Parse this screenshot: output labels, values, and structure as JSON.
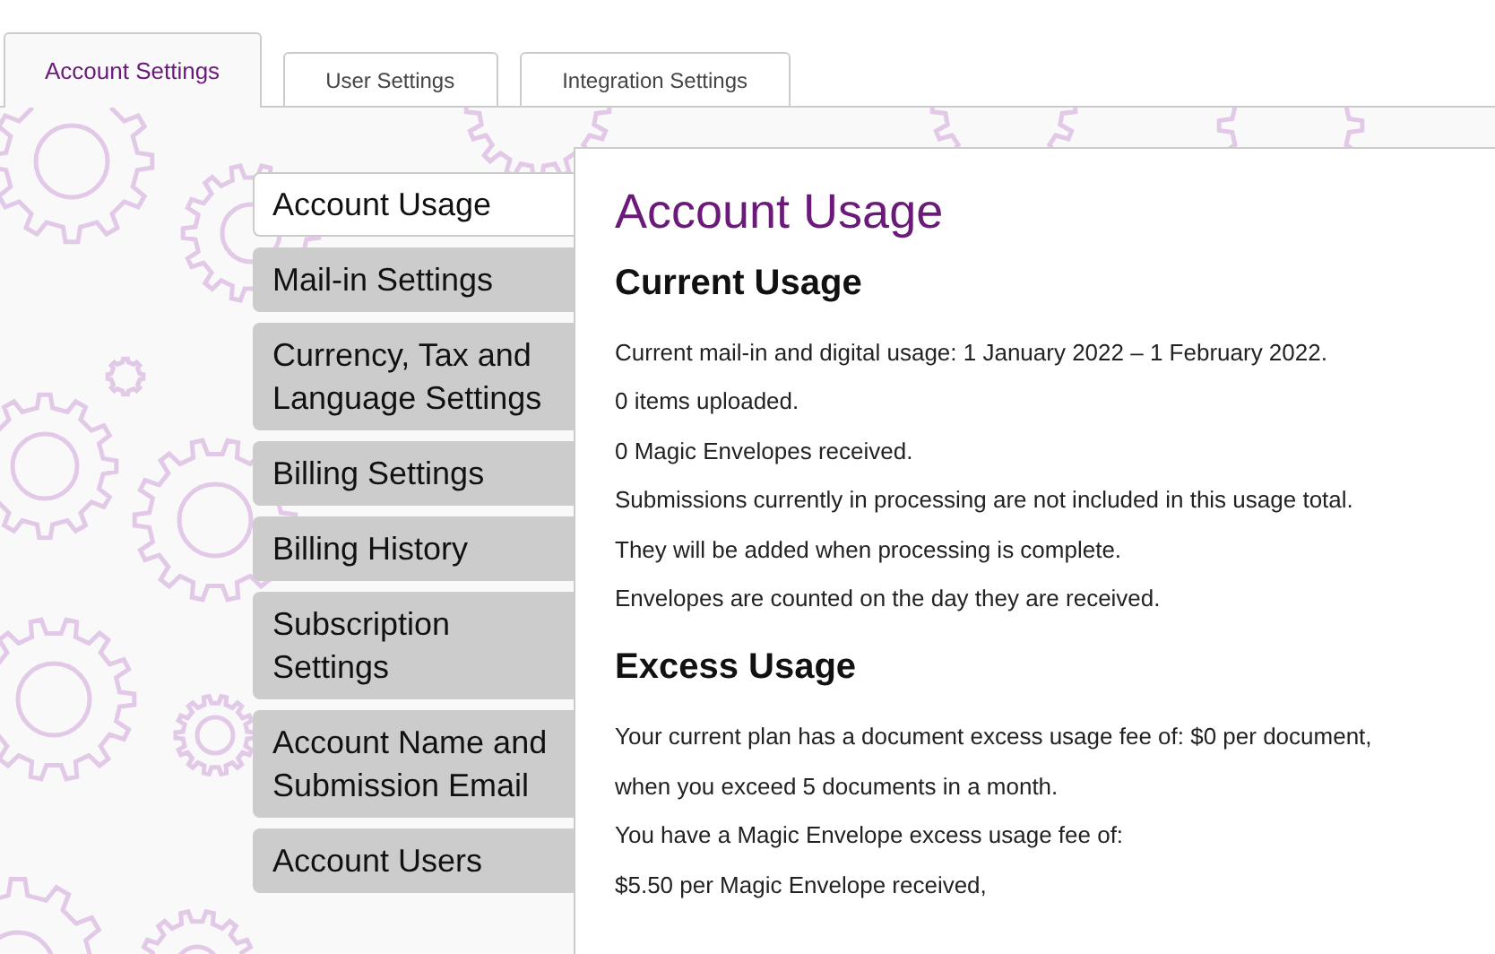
{
  "tabs": [
    {
      "label": "Account Settings",
      "selected": true
    },
    {
      "label": "User Settings",
      "selected": false
    },
    {
      "label": "Integration Settings",
      "selected": false
    }
  ],
  "sidebar": {
    "items": [
      {
        "label": "Account Usage",
        "selected": true
      },
      {
        "label": "Mail-in Settings",
        "selected": false
      },
      {
        "label": "Currency, Tax and Language Settings",
        "selected": false
      },
      {
        "label": "Billing Settings",
        "selected": false
      },
      {
        "label": "Billing History",
        "selected": false
      },
      {
        "label": "Subscription Settings",
        "selected": false
      },
      {
        "label": "Account Name and Submission Email",
        "selected": false
      },
      {
        "label": "Account Users",
        "selected": false
      }
    ]
  },
  "content": {
    "title": "Account Usage",
    "sections": [
      {
        "heading": "Current Usage",
        "lines": [
          "Current mail-in and digital usage: 1 January 2022 – 1 February 2022.",
          "0 items uploaded.",
          "0 Magic Envelopes received.",
          "Submissions currently in processing are not included in this usage total.",
          "They will be added when processing is complete.",
          "Envelopes are counted on the day they are received."
        ]
      },
      {
        "heading": "Excess Usage",
        "lines": [
          "Your current plan has a document excess usage fee of: $0 per document,",
          "when you exceed 5 documents in a month.",
          "You have a Magic Envelope excess usage fee of:",
          "$5.50 per Magic Envelope received,"
        ]
      }
    ]
  }
}
